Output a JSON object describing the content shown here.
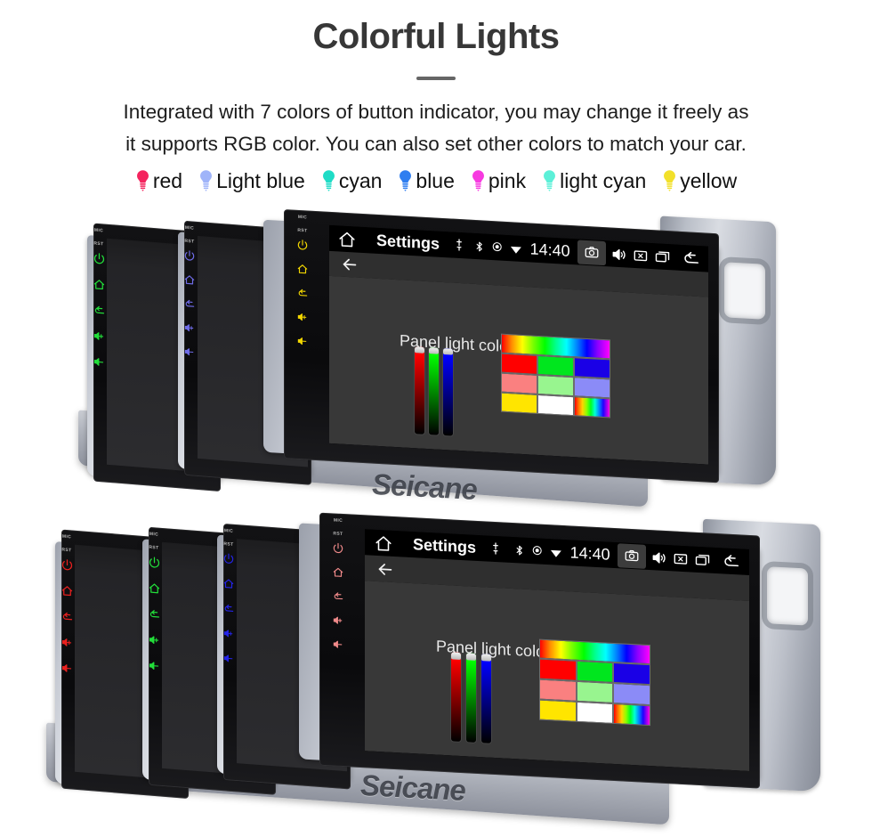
{
  "hero": {
    "title": "Colorful Lights",
    "subtitle_line1": "Integrated with 7 colors of button indicator, you may change it freely as",
    "subtitle_line2": "it supports RGB color. You can also set other colors to match your car."
  },
  "legend": {
    "items": [
      {
        "label": "red",
        "color": "#f4245e",
        "icon": "bulb-icon"
      },
      {
        "label": "Light blue",
        "color": "#9fb4f9",
        "icon": "bulb-icon"
      },
      {
        "label": "cyan",
        "color": "#1fdcc6",
        "icon": "bulb-icon"
      },
      {
        "label": "blue",
        "color": "#2f7ef0",
        "icon": "bulb-icon"
      },
      {
        "label": "pink",
        "color": "#f73ae0",
        "icon": "bulb-icon"
      },
      {
        "label": "light cyan",
        "color": "#5cf0d8",
        "icon": "bulb-icon"
      },
      {
        "label": "yellow",
        "color": "#f2e02a",
        "icon": "bulb-icon"
      }
    ]
  },
  "device_screen": {
    "status_bar": {
      "home_icon": "home-icon",
      "title": "Settings",
      "mic_icon": "mic-icon",
      "bluetooth_icon": "bluetooth-icon",
      "location_icon": "location-icon",
      "wifi_icon": "wifi-icon",
      "clock": "14:40",
      "camera_icon": "camera-icon",
      "volume_icon": "volume-icon",
      "close_icon": "close-box-icon",
      "recents_icon": "recent-apps-icon",
      "back_icon": "back-icon"
    },
    "app_bar": {
      "back_icon": "arrow-left-icon"
    },
    "panel": {
      "label": "Panel light color",
      "sliders": [
        {
          "name": "red-slider",
          "color": "#ff0000",
          "value": 100
        },
        {
          "name": "green-slider",
          "color": "#00ff00",
          "value": 100
        },
        {
          "name": "blue-slider",
          "color": "#0000ff",
          "value": 100
        }
      ],
      "rainbow_bar": "rainbow-gradient-bar",
      "swatches": [
        {
          "name": "swatch-red",
          "color": "#ff0000"
        },
        {
          "name": "swatch-green",
          "color": "#00e61e"
        },
        {
          "name": "swatch-blue",
          "color": "#1a00e6"
        },
        {
          "name": "swatch-salmon",
          "color": "#fa8080"
        },
        {
          "name": "swatch-lightgreen",
          "color": "#98f58f"
        },
        {
          "name": "swatch-periwinkle",
          "color": "#8b8bf7"
        },
        {
          "name": "swatch-yellow",
          "color": "#ffe500"
        },
        {
          "name": "swatch-white",
          "color": "#ffffff"
        },
        {
          "name": "swatch-multicolor",
          "color": "multi"
        }
      ]
    },
    "side_buttons": {
      "mic_label": "MIC",
      "rst_label": "RST",
      "icons": [
        "power-icon",
        "home-icon",
        "back-icon",
        "volume-up-icon",
        "volume-down-icon"
      ]
    }
  },
  "rows": {
    "top": {
      "units": [
        {
          "name": "unit-green",
          "indicator_color": "#22dd3a"
        },
        {
          "name": "unit-purple",
          "indicator_color": "#6f6ce8"
        },
        {
          "name": "unit-yellow",
          "indicator_color": "#f2d600"
        }
      ]
    },
    "bottom": {
      "units": [
        {
          "name": "unit-red",
          "indicator_color": "#e8201f"
        },
        {
          "name": "unit-green",
          "indicator_color": "#22dd3a"
        },
        {
          "name": "unit-blue",
          "indicator_color": "#2424e8"
        },
        {
          "name": "unit-pink",
          "indicator_color": "#f08a8a"
        }
      ]
    }
  },
  "watermark": {
    "text": "Seicane"
  }
}
